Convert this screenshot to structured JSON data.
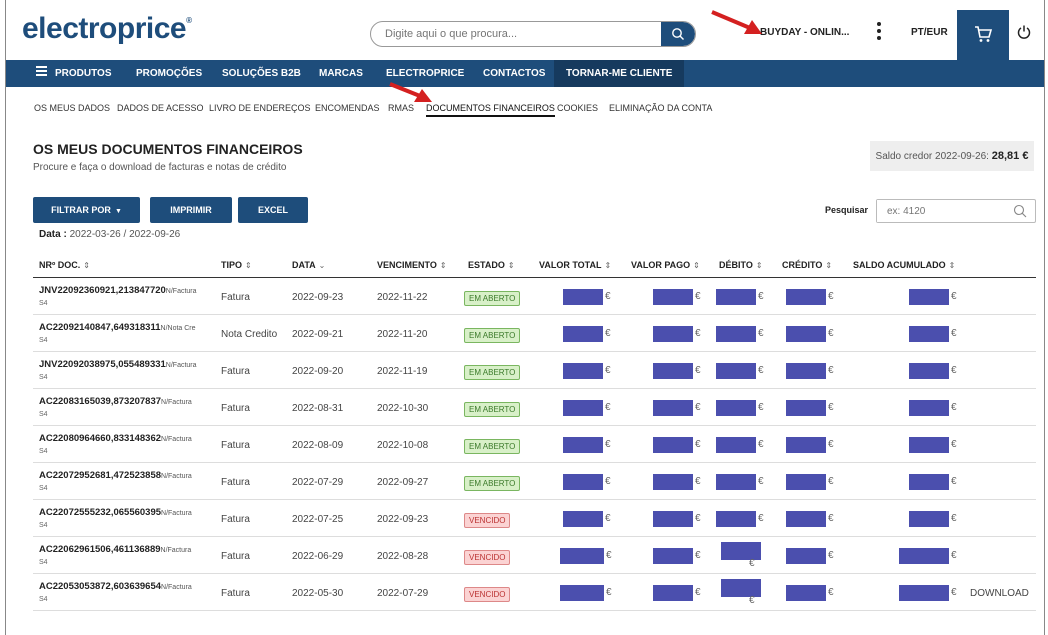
{
  "header": {
    "logo": "electroprice",
    "logo_mark": "®",
    "search_placeholder": "Digite aqui o que procura...",
    "account": "BUYDAY - ONLIN...",
    "locale": "PT/EUR"
  },
  "nav": [
    {
      "label": "PRODUTOS"
    },
    {
      "label": "PROMOÇÕES"
    },
    {
      "label": "SOLUÇÕES B2B"
    },
    {
      "label": "MARCAS"
    },
    {
      "label": "ELECTROPRICE"
    },
    {
      "label": "CONTACTOS"
    },
    {
      "label": "TORNAR-ME CLIENTE"
    }
  ],
  "subnav": [
    {
      "label": "OS MEUS DADOS"
    },
    {
      "label": "DADOS DE ACESSO"
    },
    {
      "label": "LIVRO DE ENDEREÇOS"
    },
    {
      "label": "ENCOMENDAS"
    },
    {
      "label": "RMAS"
    },
    {
      "label": "DOCUMENTOS FINANCEIROS"
    },
    {
      "label": "COOKIES"
    },
    {
      "label": "ELIMINAÇÃO DA CONTA"
    }
  ],
  "page": {
    "title": "OS MEUS DOCUMENTOS FINANCEIROS",
    "subtitle": "Procure e faça o download de facturas e notas de crédito",
    "saldo_label": "Saldo credor 2022-09-26:",
    "saldo_value": "28,81 €",
    "filter_label": "FILTRAR POR",
    "print_label": "IMPRIMIR",
    "excel_label": "EXCEL",
    "search_label": "Pesquisar",
    "search_placeholder": "ex: 4120",
    "date_label": "Data :",
    "date_value": "2022-03-26 / 2022-09-26"
  },
  "table": {
    "columns": [
      "NRº DOC.",
      "TIPO",
      "DATA",
      "VENCIMENTO",
      "ESTADO",
      "VALOR TOTAL",
      "VALOR PAGO",
      "DÉBITO",
      "CRÉDITO",
      "SALDO ACUMULADO"
    ],
    "currency": "€",
    "download_label": "DOWNLOAD",
    "rows": [
      {
        "doc": "JNV22092360921,213847720",
        "kind": "N/Factura",
        "sub": "S4",
        "tipo": "Fatura",
        "data": "2022-09-23",
        "venc": "2022-11-22",
        "estado": "EM ABERTO",
        "status": "open"
      },
      {
        "doc": "AC22092140847,649318311",
        "kind": "N/Nota Cre",
        "sub": "S4",
        "tipo": "Nota Credito",
        "data": "2022-09-21",
        "venc": "2022-11-20",
        "estado": "EM ABERTO",
        "status": "open"
      },
      {
        "doc": "JNV22092038975,055489331",
        "kind": "N/Factura",
        "sub": "S4",
        "tipo": "Fatura",
        "data": "2022-09-20",
        "venc": "2022-11-19",
        "estado": "EM ABERTO",
        "status": "open"
      },
      {
        "doc": "AC22083165039,873207837",
        "kind": "N/Factura",
        "sub": "S4",
        "tipo": "Fatura",
        "data": "2022-08-31",
        "venc": "2022-10-30",
        "estado": "EM ABERTO",
        "status": "open"
      },
      {
        "doc": "AC22080964660,833148362",
        "kind": "N/Factura",
        "sub": "S4",
        "tipo": "Fatura",
        "data": "2022-08-09",
        "venc": "2022-10-08",
        "estado": "EM ABERTO",
        "status": "open"
      },
      {
        "doc": "AC22072952681,472523858",
        "kind": "N/Factura",
        "sub": "S4",
        "tipo": "Fatura",
        "data": "2022-07-29",
        "venc": "2022-09-27",
        "estado": "EM ABERTO",
        "status": "open"
      },
      {
        "doc": "AC22072555232,065560395",
        "kind": "N/Factura",
        "sub": "S4",
        "tipo": "Fatura",
        "data": "2022-07-25",
        "venc": "2022-09-23",
        "estado": "VENCIDO",
        "status": "late"
      },
      {
        "doc": "AC22062961506,461136889",
        "kind": "N/Factura",
        "sub": "S4",
        "tipo": "Fatura",
        "data": "2022-06-29",
        "venc": "2022-08-28",
        "estado": "VENCIDO",
        "status": "late"
      },
      {
        "doc": "AC22053053872,603639654",
        "kind": "N/Factura",
        "sub": "S4",
        "tipo": "Fatura",
        "data": "2022-05-30",
        "venc": "2022-07-29",
        "estado": "VENCIDO",
        "status": "late",
        "download": true
      }
    ]
  },
  "colors": {
    "brand": "#1e4d7b",
    "redaction": "#4b4fae",
    "arrow": "#d42020"
  }
}
